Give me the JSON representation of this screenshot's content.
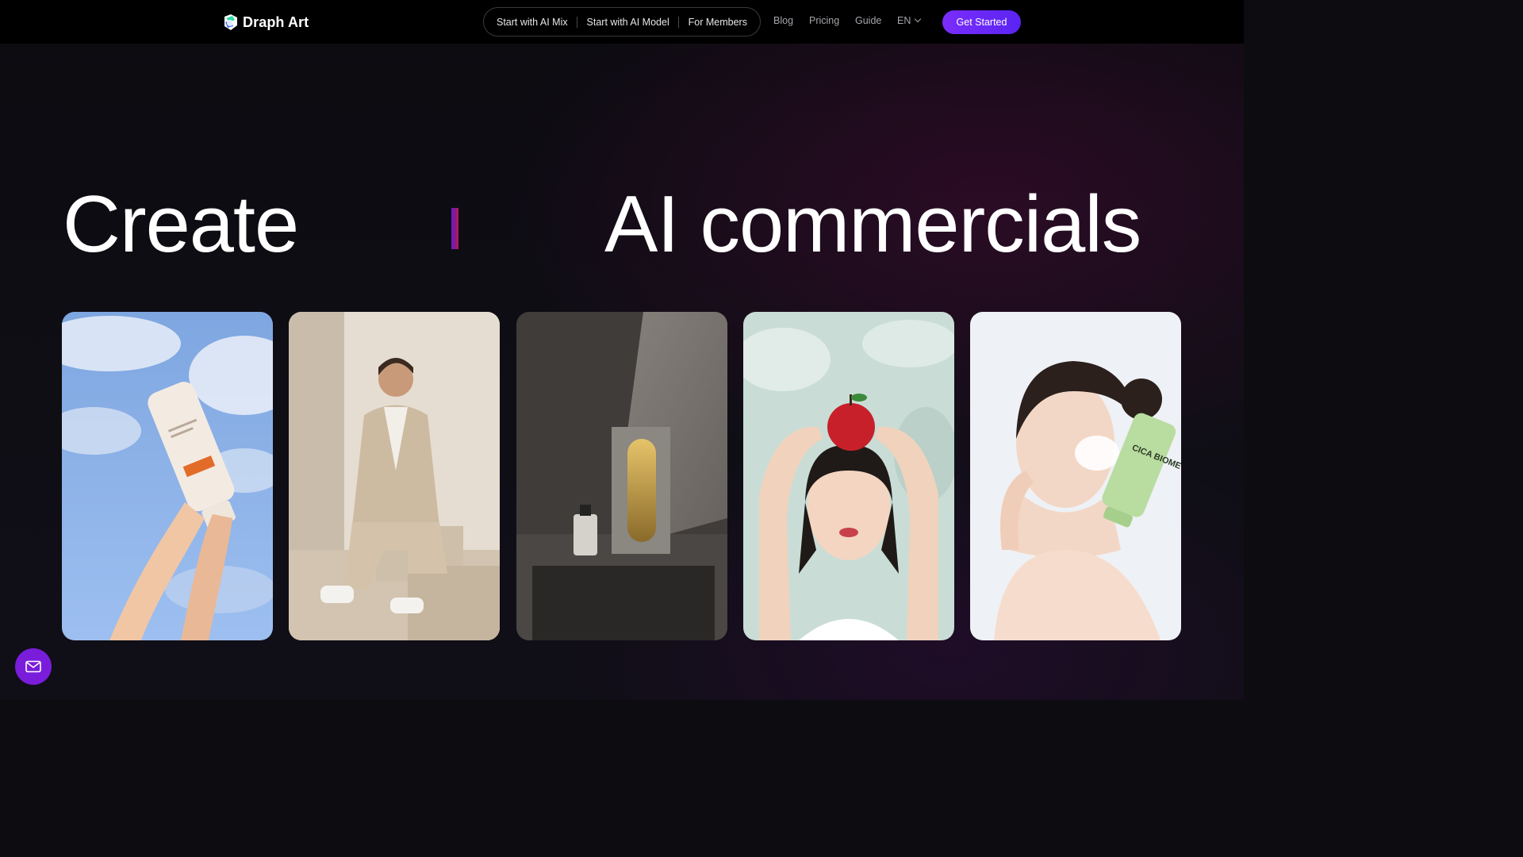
{
  "brand": {
    "name": "Draph Art",
    "icon": "draph-logo"
  },
  "nav": {
    "pill_items": [
      "Start with AI Mix",
      "Start with AI Model",
      "For Members"
    ],
    "links": {
      "blog": "Blog",
      "pricing": "Pricing",
      "guide": "Guide",
      "language": "EN"
    },
    "cta": "Get Started"
  },
  "hero": {
    "headline_start": "Create",
    "headline_end": "AI commercials",
    "accent_color": "#7a2dfb"
  },
  "gallery": [
    {
      "icon": "sunscreen-tube-sky-photo"
    },
    {
      "icon": "man-in-suit-photo"
    },
    {
      "icon": "perfume-bottle-concrete-photo"
    },
    {
      "icon": "woman-with-apple-photo"
    },
    {
      "icon": "woman-with-cica-cream-photo",
      "label": "CICA BIOME"
    }
  ],
  "floating_button": {
    "icon": "mail-icon"
  }
}
